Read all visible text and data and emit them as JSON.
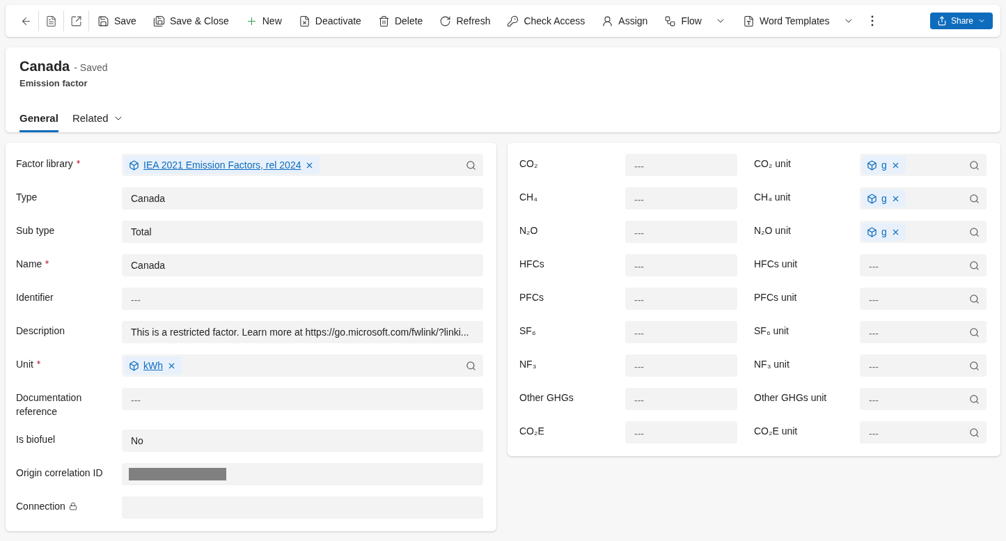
{
  "toolbar": {
    "icon_buttons": [
      {
        "kind": "back"
      },
      {
        "kind": "form"
      },
      {
        "kind": "popout"
      }
    ],
    "commands": [
      {
        "kind": "save",
        "label": "Save",
        "dropdown": false
      },
      {
        "kind": "save_close",
        "label": "Save & Close",
        "dropdown": false
      },
      {
        "kind": "new",
        "label": "New",
        "dropdown": false
      },
      {
        "kind": "deactivate",
        "label": "Deactivate",
        "dropdown": false
      },
      {
        "kind": "delete",
        "label": "Delete",
        "dropdown": false
      },
      {
        "kind": "refresh",
        "label": "Refresh",
        "dropdown": false
      },
      {
        "kind": "check_access",
        "label": "Check Access",
        "dropdown": false
      },
      {
        "kind": "assign",
        "label": "Assign",
        "dropdown": false
      },
      {
        "kind": "flow",
        "label": "Flow",
        "dropdown": true
      },
      {
        "kind": "word",
        "label": "Word Templates",
        "dropdown": true
      }
    ],
    "share": {
      "label": "Share"
    }
  },
  "header": {
    "title": "Canada",
    "status": "- Saved",
    "entity": "Emission factor",
    "tabs": [
      {
        "label": "General",
        "selected": true,
        "dropdown": false
      },
      {
        "label": "Related",
        "selected": false,
        "dropdown": true
      }
    ]
  },
  "general_fields": [
    {
      "label": "Factor library",
      "required": true,
      "kind": "lookup",
      "chip": "IEA 2021 Emission Factors, rel 2024"
    },
    {
      "label": "Type",
      "required": false,
      "kind": "text",
      "value": "Canada"
    },
    {
      "label": "Sub type",
      "required": false,
      "kind": "text",
      "value": "Total"
    },
    {
      "label": "Name",
      "required": true,
      "kind": "text",
      "value": "Canada"
    },
    {
      "label": "Identifier",
      "required": false,
      "kind": "empty",
      "placeholder": "---"
    },
    {
      "label": "Description",
      "required": false,
      "kind": "text",
      "value": "This is a restricted factor. Learn more at https://go.microsoft.com/fwlink/?linki..."
    },
    {
      "label": "Unit",
      "required": true,
      "kind": "lookup",
      "chip": "kWh"
    },
    {
      "label": "Documentation reference",
      "required": false,
      "kind": "empty",
      "placeholder": "---"
    },
    {
      "label": "Is biofuel",
      "required": false,
      "kind": "text",
      "value": "No"
    },
    {
      "label": "Origin correlation ID",
      "required": false,
      "kind": "redacted"
    },
    {
      "label": "Connection",
      "required": false,
      "locked": true,
      "kind": "blank"
    }
  ],
  "gases": [
    {
      "label": "CO₂",
      "placeholder": "---",
      "unit_label": "CO₂ unit",
      "unit": {
        "kind": "chip",
        "chip": "g"
      }
    },
    {
      "label": "CH₄",
      "placeholder": "---",
      "unit_label": "CH₄ unit",
      "unit": {
        "kind": "chip",
        "chip": "g"
      }
    },
    {
      "label": "N₂O",
      "placeholder": "---",
      "unit_label": "N₂O unit",
      "unit": {
        "kind": "chip",
        "chip": "g"
      }
    },
    {
      "label": "HFCs",
      "placeholder": "---",
      "unit_label": "HFCs unit",
      "unit": {
        "kind": "empty",
        "placeholder": "---"
      }
    },
    {
      "label": "PFCs",
      "placeholder": "---",
      "unit_label": "PFCs unit",
      "unit": {
        "kind": "empty",
        "placeholder": "---"
      }
    },
    {
      "label": "SF₆",
      "placeholder": "---",
      "unit_label": "SF₆ unit",
      "unit": {
        "kind": "empty",
        "placeholder": "---"
      }
    },
    {
      "label": "NF₃",
      "placeholder": "---",
      "unit_label": "NF₃ unit",
      "unit": {
        "kind": "empty",
        "placeholder": "---"
      }
    },
    {
      "label": "Other GHGs",
      "placeholder": "---",
      "unit_label": "Other GHGs unit",
      "unit": {
        "kind": "empty",
        "placeholder": "---"
      }
    },
    {
      "label": "CO₂E",
      "placeholder": "---",
      "unit_label": "CO₂E unit",
      "unit": {
        "kind": "empty",
        "placeholder": "---"
      }
    }
  ]
}
